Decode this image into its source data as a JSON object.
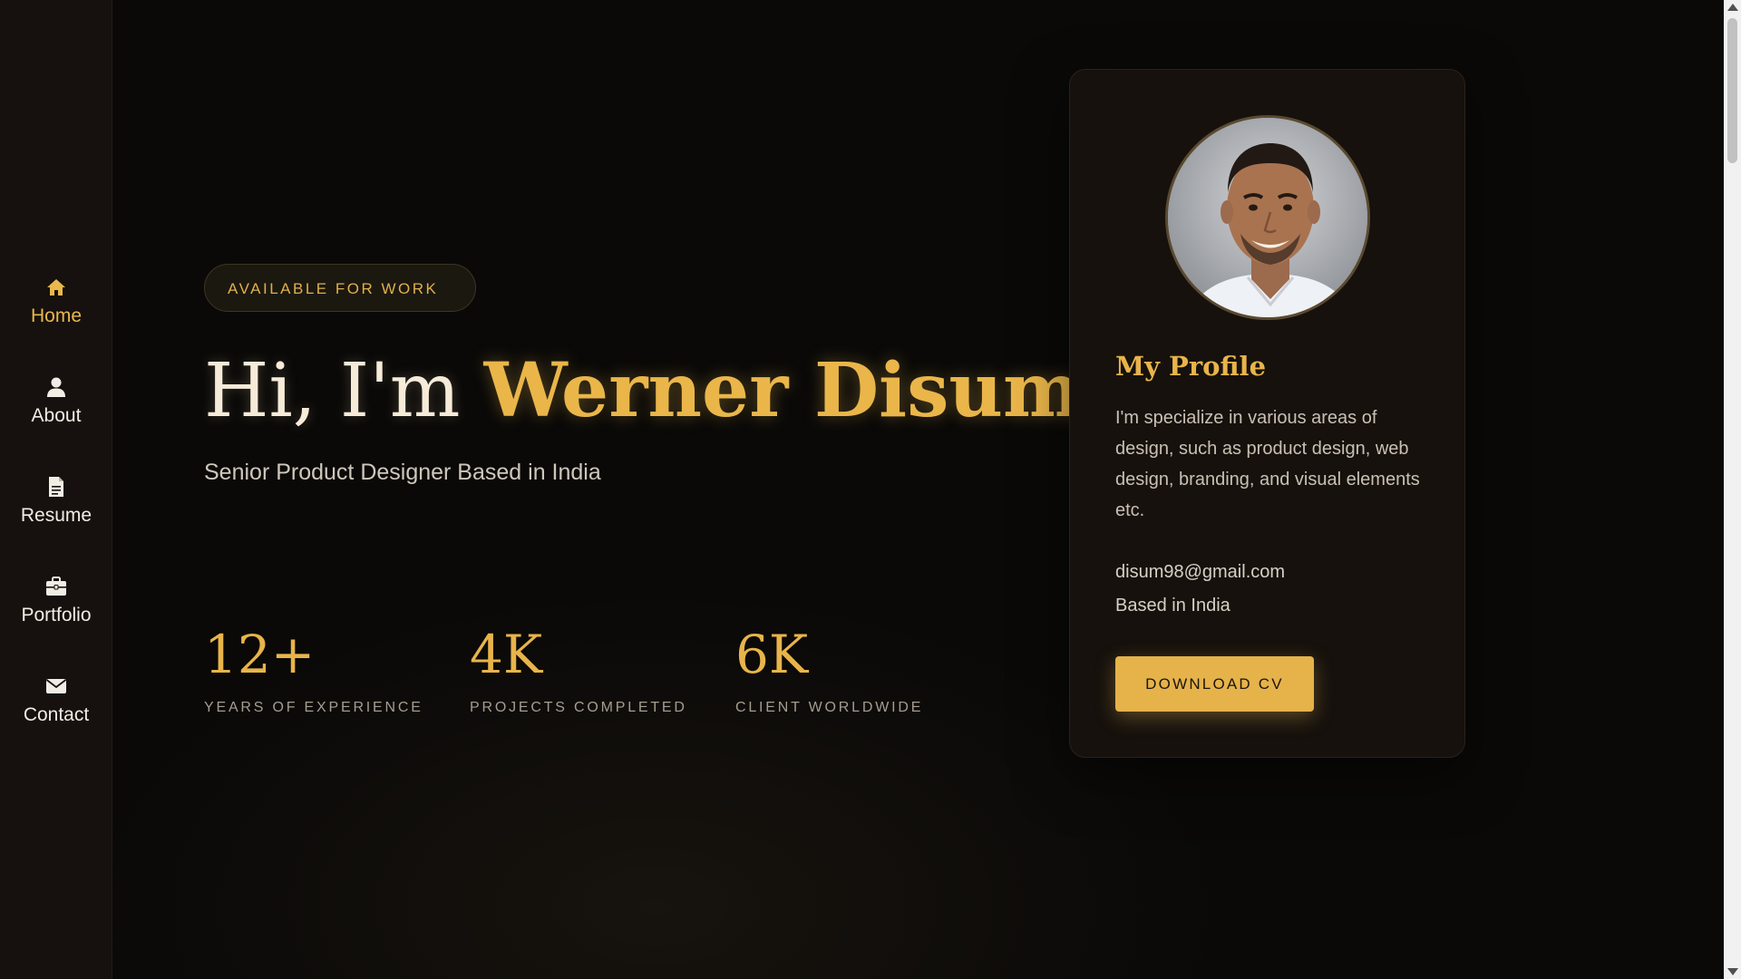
{
  "sidebar": {
    "items": [
      {
        "label": "Home",
        "icon": "home-icon",
        "active": true
      },
      {
        "label": "About",
        "icon": "user-icon",
        "active": false
      },
      {
        "label": "Resume",
        "icon": "document-icon",
        "active": false
      },
      {
        "label": "Portfolio",
        "icon": "briefcase-icon",
        "active": false
      },
      {
        "label": "Contact",
        "icon": "envelope-icon",
        "active": false
      }
    ]
  },
  "hero": {
    "badge": "AVAILABLE FOR WORK",
    "greeting": "Hi, I'm ",
    "name": "Werner Disum",
    "subtitle": "Senior Product Designer Based in India"
  },
  "stats": [
    {
      "value": "12+",
      "caption": "YEARS OF EXPERIENCE"
    },
    {
      "value": "4K",
      "caption": "PROJECTS COMPLETED"
    },
    {
      "value": "6K",
      "caption": "CLIENT WORLDWIDE"
    }
  ],
  "profile": {
    "title": "My Profile",
    "description": "I'm specialize in various areas of design, such as product design, web design, branding, and visual elements etc.",
    "email": "disum98@gmail.com",
    "location": "Based in India",
    "button_label": "DOWNLOAD CV"
  },
  "colors": {
    "accent": "#e8b44a",
    "background": "#0a0908",
    "sidebar": "#16110e"
  }
}
